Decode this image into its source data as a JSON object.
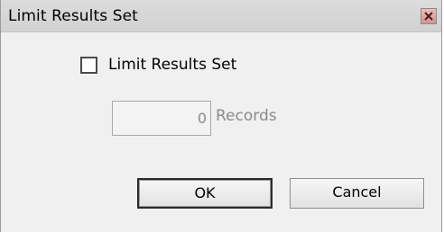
{
  "window": {
    "title": "Limit Results Set",
    "close_icon": "close-icon",
    "close_color": "#d88f8c"
  },
  "form": {
    "limit_checkbox": {
      "label": "Limit Results Set",
      "checked": false
    },
    "records": {
      "value": "0",
      "unit_label": "Records",
      "enabled": false
    }
  },
  "buttons": {
    "ok_label": "OK",
    "cancel_label": "Cancel"
  }
}
